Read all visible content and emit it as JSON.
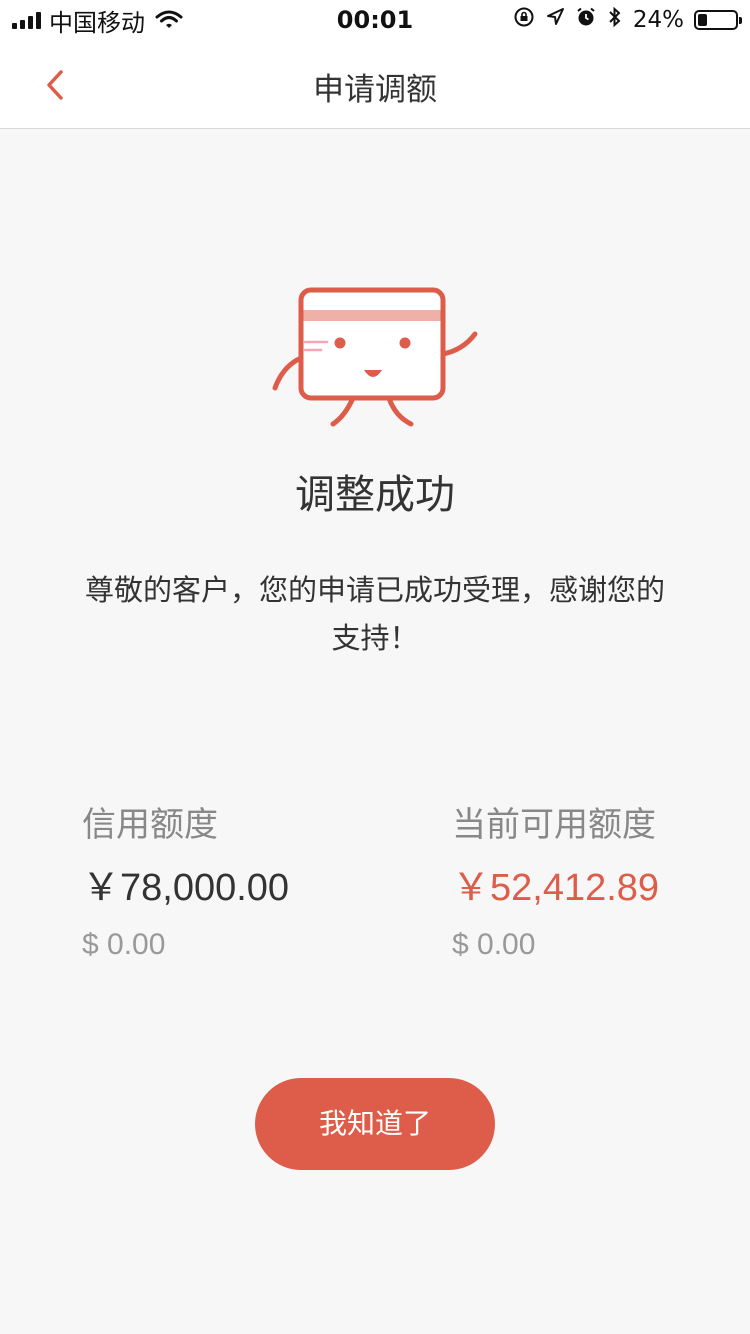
{
  "status_bar": {
    "carrier": "中国移动",
    "time": "00:01",
    "battery_percent": "24%",
    "battery_level": 0.24,
    "icons": [
      "signal-icon",
      "wifi-icon",
      "orientation-lock-icon",
      "location-icon",
      "alarm-icon",
      "bluetooth-icon",
      "battery-icon"
    ]
  },
  "nav": {
    "title": "申请调额",
    "back_icon": "chevron-left-icon"
  },
  "result": {
    "illustration": "card-mascot-icon",
    "title": "调整成功",
    "message": "尊敬的客户，您的申请已成功受理，感谢您的支持！"
  },
  "credit_limit": {
    "label": "信用额度",
    "cny": "￥78,000.00",
    "usd": "$ 0.00"
  },
  "available_limit": {
    "label": "当前可用额度",
    "cny": "￥52,412.89",
    "usd": "$ 0.00"
  },
  "confirm_button": {
    "label": "我知道了"
  },
  "colors": {
    "accent": "#dd5d4a",
    "background": "#f7f7f7"
  }
}
